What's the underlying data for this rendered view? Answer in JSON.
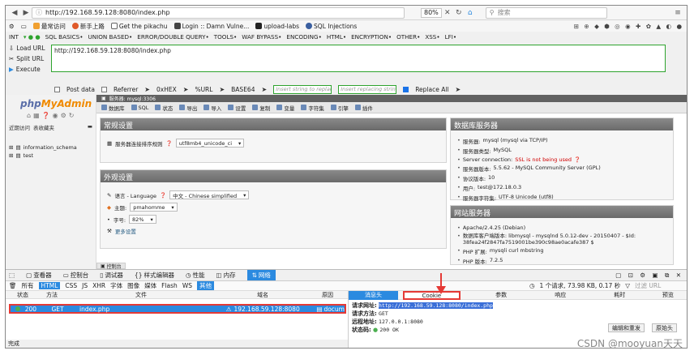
{
  "browser": {
    "url": "http://192.168.59.128:8080/index.php",
    "zoom": "80%",
    "search_placeholder": "搜索"
  },
  "bookmarks": [
    {
      "label": "最常访问",
      "color": "#f0a030"
    },
    {
      "label": "新手上路",
      "color": "#e05a2a"
    },
    {
      "label": "Get the pikachu",
      "color": "#555555"
    },
    {
      "label": "Login :: Damn Vulne...",
      "color": "#444444"
    },
    {
      "label": "upload-labs",
      "color": "#222222"
    },
    {
      "label": "SQL Injections",
      "color": "#3a5fa0"
    }
  ],
  "hackbar": {
    "menu": [
      "INT",
      "SQL BASICS•",
      "UNION BASED•",
      "ERROR/DOUBLE QUERY•",
      "TOOLS•",
      "WAF BYPASS•",
      "ENCODING•",
      "HTML•",
      "ENCRYPTION•",
      "OTHER•",
      "XSS•",
      "LFI•"
    ],
    "load_url": "Load URL",
    "split_url": "Split URL",
    "execute": "Execute",
    "url_value": "http://192.168.59.128:8080/index.php",
    "post_data": "Post data",
    "referrer": "Referrer",
    "hex": "0xHEX",
    "url_enc": "%URL",
    "base64": "BASE64",
    "insert_replace": "Insert string to replace",
    "insert_replacing": "Insert replacing string",
    "replace_all": "Replace All"
  },
  "pma": {
    "logo_php": "php",
    "logo_admin": "MyAdmin",
    "left_links": [
      "近期访问",
      "表收藏夹"
    ],
    "databases": [
      "information_schema",
      "test"
    ],
    "top_bar": "服务器: mysql:3306",
    "menu": [
      "数据库",
      "SQL",
      "状态",
      "导出",
      "导入",
      "设置",
      "复制",
      "变量",
      "字符集",
      "引擎",
      "插件"
    ],
    "general_settings": {
      "title": "常规设置",
      "collation_label": "服务器连接排序规则",
      "collation_value": "utf8mb4_unicode_ci"
    },
    "appearance": {
      "title": "外观设置",
      "language_label": "语言 - Language",
      "language_value": "中文 - Chinese simplified",
      "theme_label": "主题:",
      "theme_value": "pmahomme",
      "font_label": "字号:",
      "font_value": "82%",
      "more": "更多设置"
    },
    "db_server": {
      "title": "数据库服务器",
      "items": [
        {
          "label": "服务器:",
          "value": "mysql (mysql via TCP/IP)"
        },
        {
          "label": "服务器类型:",
          "value": "MySQL"
        },
        {
          "label": "Server connection:",
          "value": "SSL is not being used"
        },
        {
          "label": "服务器版本:",
          "value": "5.5.62 - MySQL Community Server (GPL)"
        },
        {
          "label": "协议版本:",
          "value": "10"
        },
        {
          "label": "用户:",
          "value": "test@172.18.0.3"
        },
        {
          "label": "服务器字符集:",
          "value": "UTF-8 Unicode (utf8)"
        }
      ]
    },
    "web_server": {
      "title": "网站服务器",
      "items": [
        {
          "label": "",
          "value": "Apache/2.4.25 (Debian)"
        },
        {
          "label": "数据库客户端版本:",
          "value": "libmysql - mysqlnd 5.0.12-dev - 20150407 - $Id: 38fea24f2847fa7519001be390c98ae0acafe387 $"
        },
        {
          "label": "PHP 扩展:",
          "value": "mysqli  curl  mbstring"
        },
        {
          "label": "PHP 版本:",
          "value": "7.2.5"
        }
      ]
    },
    "console": "控制台"
  },
  "devtools": {
    "tabs": [
      "查看器",
      "控制台",
      "调试器",
      "样式编辑器",
      "性能",
      "内存",
      "网络"
    ],
    "filters": [
      "所有",
      "HTML",
      "CSS",
      "JS",
      "XHR",
      "字体",
      "图像",
      "媒体",
      "Flash",
      "WS",
      "其他"
    ],
    "summary": "1 个请求, 73.98 KB, 0.17 秒",
    "filter_placeholder": "过滤 URL",
    "columns": [
      "状态",
      "方法",
      "文件",
      "域名",
      "原因"
    ],
    "request": {
      "status": "200",
      "method": "GET",
      "file": "index.php",
      "domain": "192.168.59.128:8080",
      "cause": "docum"
    },
    "detail_tabs": [
      "消息头",
      "Cookie",
      "参数",
      "响应",
      "耗时",
      "预览"
    ],
    "detail": {
      "url_label": "请求网址:",
      "url_value": "http://192.168.59.128:8080/index.php",
      "method_label": "请求方法:",
      "method_value": "GET",
      "addr_label": "远程地址:",
      "addr_value": "127.0.0.1:8080",
      "status_label": "状态码:",
      "status_value": "200 OK"
    },
    "edit_resend": "编辑和重发",
    "raw_headers": "原始头",
    "footer": "完成"
  },
  "watermark": "CSDN @mooyuan天天",
  "colors": {
    "accent": "#2b8ae0",
    "highlight_border": "#e53935",
    "hackbar_green": "#2ea32e"
  }
}
